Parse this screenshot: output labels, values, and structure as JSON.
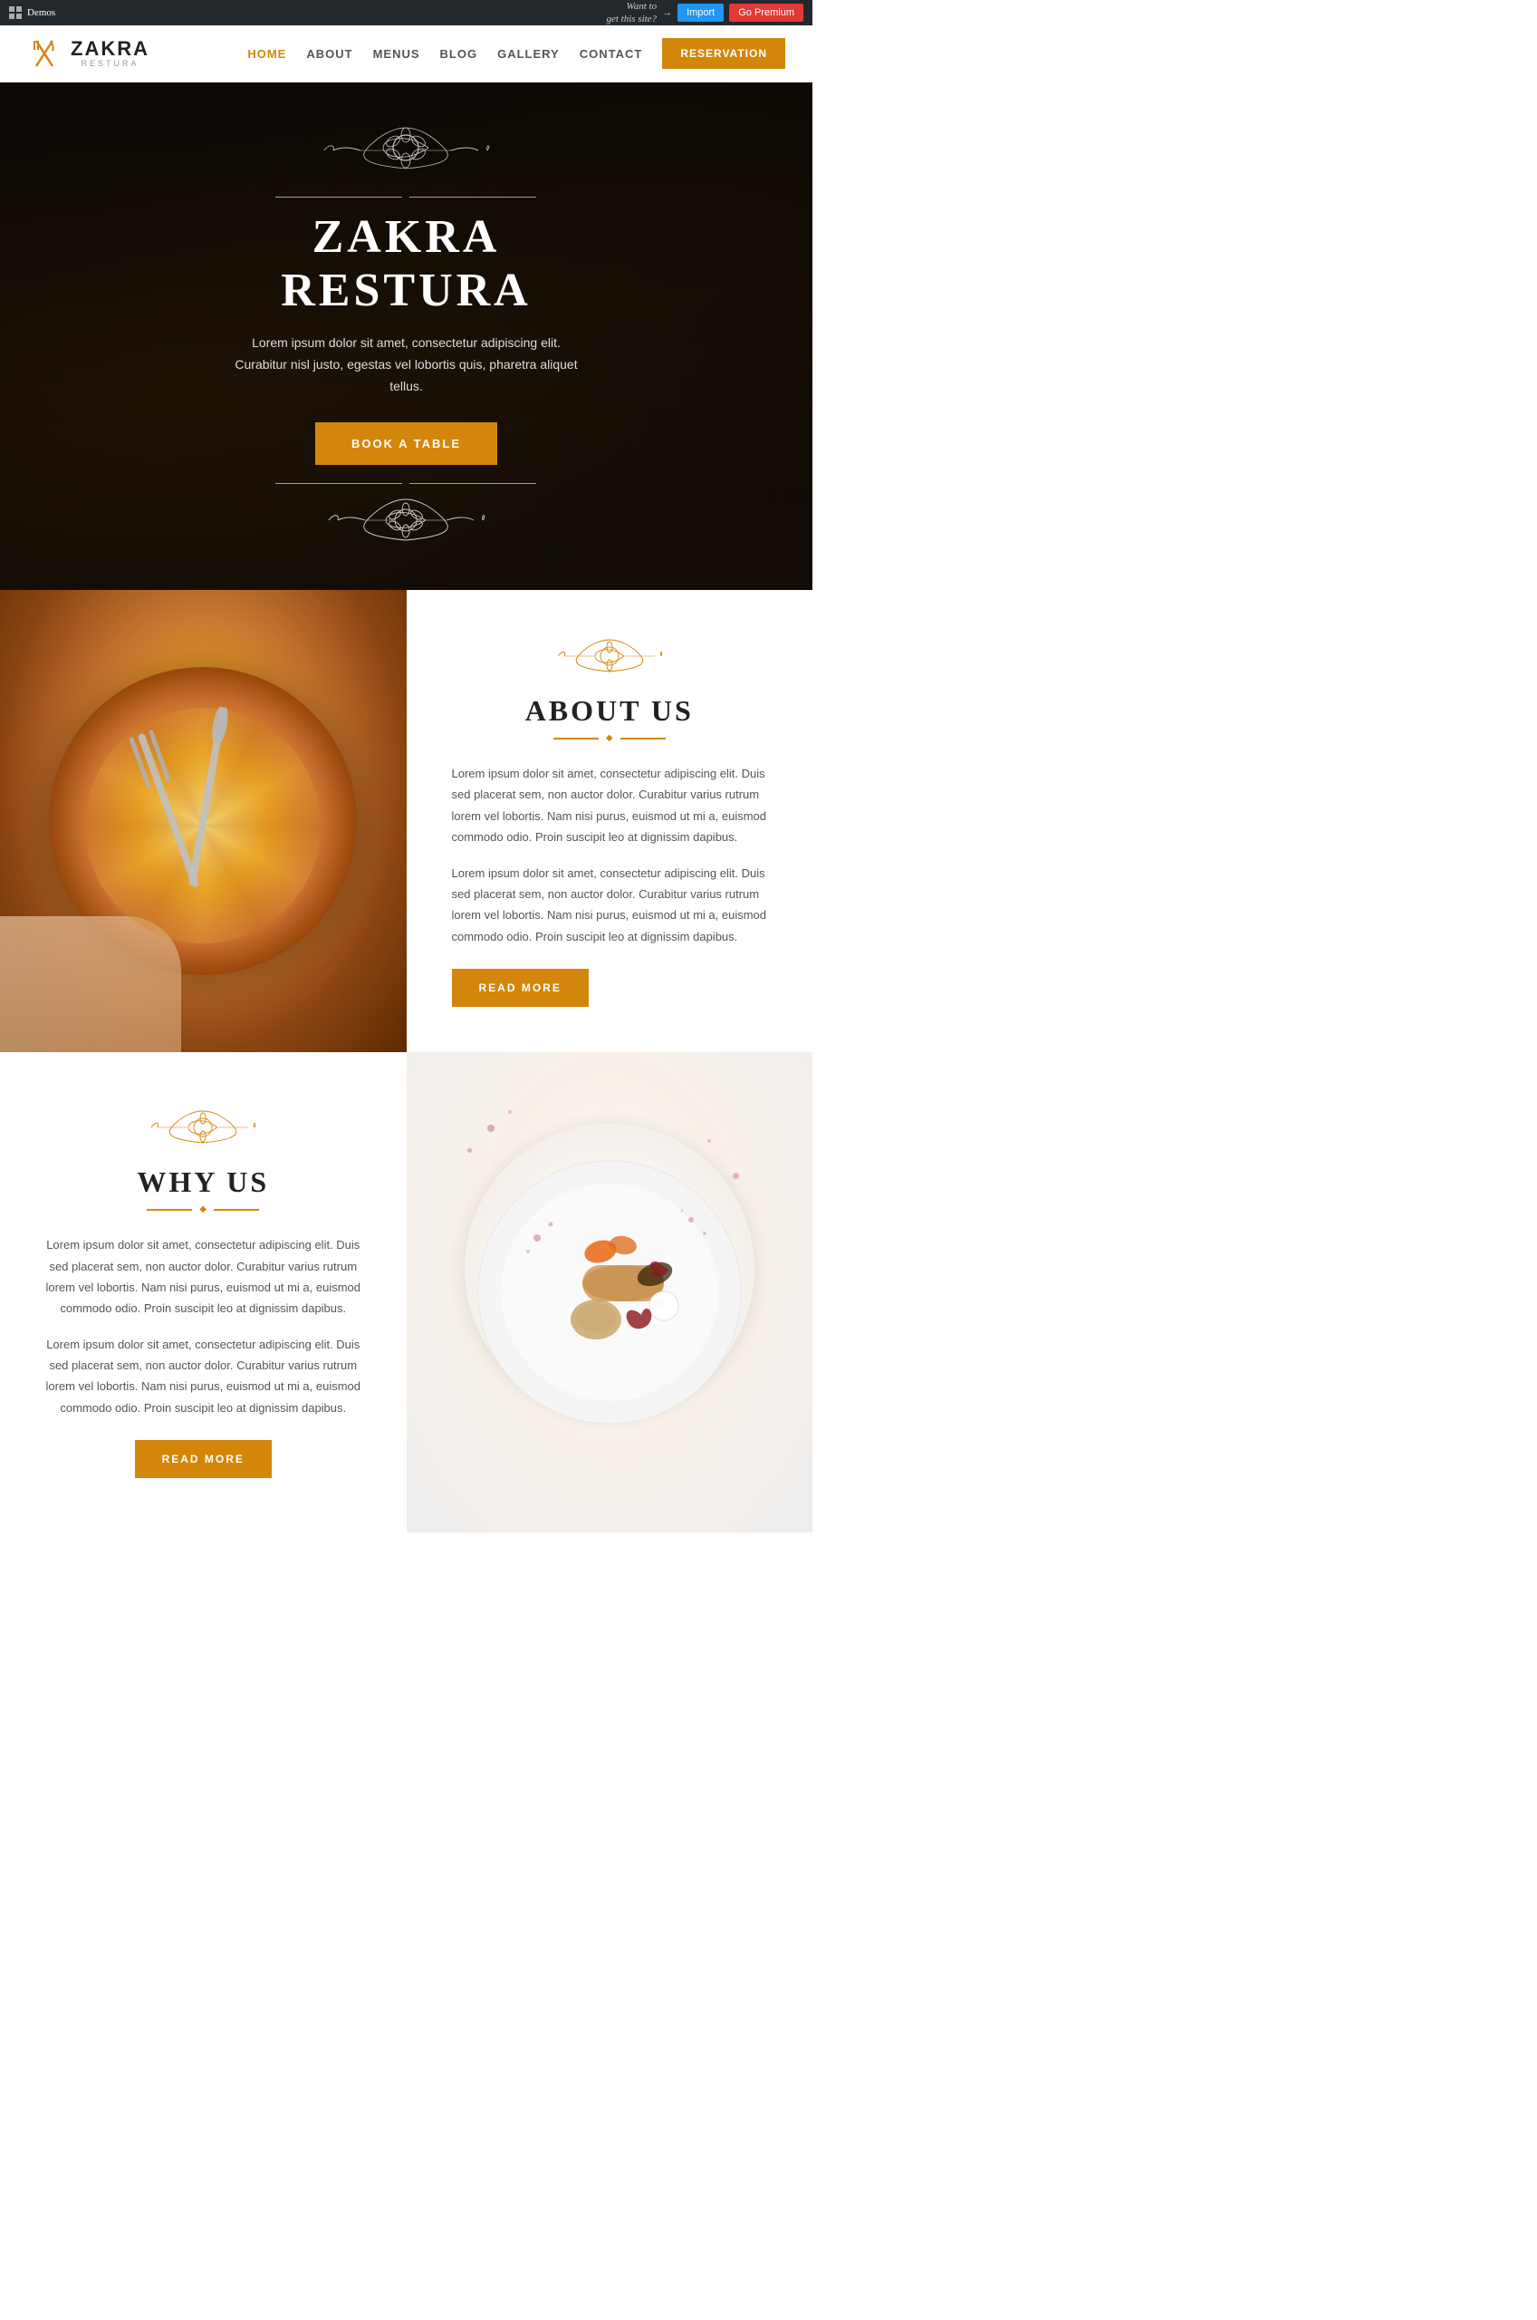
{
  "adminBar": {
    "demoLabel": "Demos",
    "wantToText": "Want to\nget this site?",
    "importLabel": "Import",
    "premiumLabel": "Go Premium"
  },
  "header": {
    "logoTitle": "ZAKRA",
    "logoSub": "RESTURA",
    "nav": [
      {
        "label": "HOME",
        "active": true
      },
      {
        "label": "ABOUT",
        "active": false
      },
      {
        "label": "MENUS",
        "active": false
      },
      {
        "label": "BLOG",
        "active": false
      },
      {
        "label": "GALLERY",
        "active": false
      },
      {
        "label": "CONTACT",
        "active": false
      }
    ],
    "reservationLabel": "RESERVATION"
  },
  "hero": {
    "title1": "ZAKRA",
    "title2": "RESTURA",
    "subtitle": "Lorem ipsum dolor sit amet, consectetur adipiscing elit.\nCurabitur nisl justo, egestas vel lobortis quis, pharetra aliquet\ntellus.",
    "bookButton": "BOOK A TABLE"
  },
  "aboutUs": {
    "sectionTitle": "ABOUT US",
    "text1": "Lorem ipsum dolor sit amet, consectetur adipiscing elit. Duis sed placerat sem, non auctor dolor. Curabitur varius rutrum lorem vel lobortis. Nam nisi purus, euismod ut mi a, euismod commodo odio. Proin suscipit leo at dignissim dapibus.",
    "text2": "Lorem ipsum dolor sit amet, consectetur adipiscing elit. Duis sed placerat sem, non auctor dolor. Curabitur varius rutrum lorem vel lobortis. Nam nisi purus, euismod ut mi a, euismod commodo odio. Proin suscipit leo at dignissim dapibus.",
    "readMoreLabel": "READ MORE"
  },
  "whyUs": {
    "sectionTitle": "WHY US",
    "text1": "Lorem ipsum dolor sit amet, consectetur adipiscing elit. Duis sed placerat sem, non auctor dolor. Curabitur varius rutrum lorem vel lobortis. Nam nisi purus, euismod ut mi a, euismod commodo odio. Proin suscipit leo at dignissim dapibus.",
    "text2": "Lorem ipsum dolor sit amet, consectetur adipiscing elit. Duis sed placerat sem, non auctor dolor. Curabitur varius rutrum lorem vel lobortis. Nam nisi purus, euismod ut mi a, euismod commodo odio. Proin suscipit leo at dignissim dapibus.",
    "readMoreLabel": "READ MORE"
  },
  "colors": {
    "accent": "#d4860a",
    "dark": "#222222",
    "light": "#ffffff",
    "text": "#555555"
  }
}
